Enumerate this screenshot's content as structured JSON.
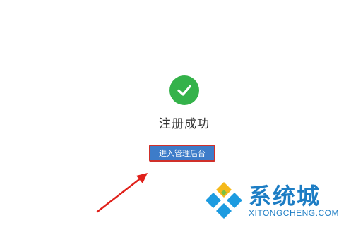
{
  "success": {
    "title": "注册成功",
    "button_label": "进入管理后台",
    "icon": "checkmark-circle-icon",
    "icon_color": "#34b24a"
  },
  "annotation": {
    "arrow_color": "#e0201a",
    "highlight_color": "#d0302a"
  },
  "watermark": {
    "brand": "系统城",
    "domain": "XITONGCHENG.COM",
    "brand_color": "#1d7dc4"
  }
}
